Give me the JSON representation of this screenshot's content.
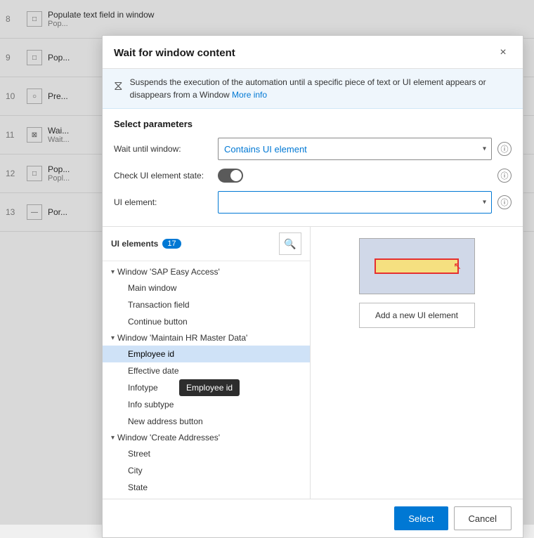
{
  "bg": {
    "rows": [
      {
        "num": "8",
        "icon": "□",
        "title": "Populate text field in window",
        "sub": "Pop..."
      },
      {
        "num": "9",
        "icon": "□",
        "title": "Pop...",
        "sub": ""
      },
      {
        "num": "10",
        "icon": "○",
        "title": "Pre...",
        "sub": ""
      },
      {
        "num": "11",
        "icon": "⊠",
        "title": "Wai...",
        "sub": "Wait..."
      },
      {
        "num": "12",
        "icon": "□",
        "title": "Pop...",
        "sub": "Popl..."
      },
      {
        "num": "13",
        "icon": "—",
        "title": "Por...",
        "sub": ""
      }
    ]
  },
  "dialog": {
    "title": "Wait for window content",
    "close_label": "×",
    "info_text": "Suspends the execution of the automation until a specific piece of text or UI element appears or disappears from a Window",
    "info_link_text": "More info",
    "params_title": "Select parameters",
    "wait_until_label": "Wait until window:",
    "wait_until_value": "Contains UI element",
    "check_state_label": "Check UI element state:",
    "ui_element_label": "UI element:",
    "ui_elements_panel": {
      "title": "UI elements",
      "badge": "17",
      "search_placeholder": "Search",
      "groups": [
        {
          "name": "Window 'SAP Easy Access'",
          "items": [
            "Main window",
            "Transaction field",
            "Continue button"
          ]
        },
        {
          "name": "Window 'Maintain HR Master Data'",
          "items": [
            "Employee id",
            "Effective date",
            "Infotype",
            "Info subtype",
            "New address button"
          ]
        },
        {
          "name": "Window 'Create Addresses'",
          "items": [
            "Street",
            "City",
            "State"
          ]
        }
      ]
    },
    "add_element_label": "Add a new UI element",
    "tooltip_text": "Employee id",
    "select_label": "Select",
    "cancel_label": "Cancel"
  }
}
